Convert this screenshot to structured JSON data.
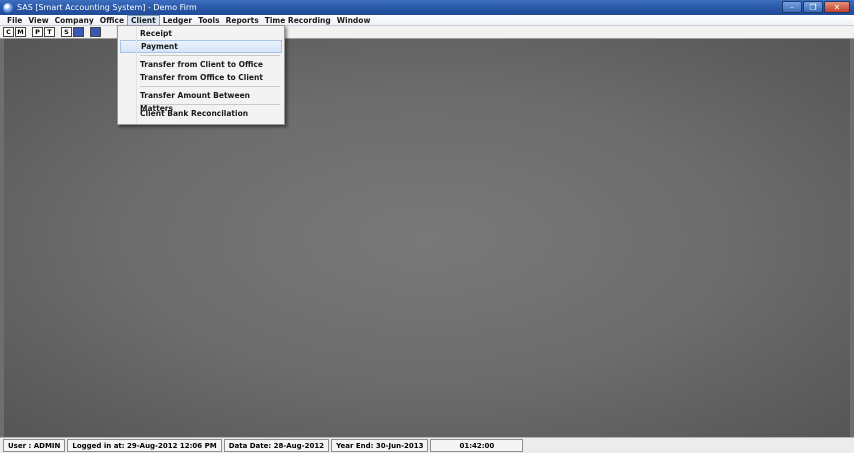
{
  "window": {
    "title": "SAS [Smart Accounting System] - Demo Firm",
    "buttons": {
      "minimize": "–",
      "restore": "❐",
      "close": "✕"
    }
  },
  "menubar": {
    "items": [
      "File",
      "View",
      "Company",
      "Office",
      "Client",
      "Ledger",
      "Tools",
      "Reports",
      "Time Recording",
      "Window"
    ],
    "active": "Client"
  },
  "toolbar": {
    "buttons": [
      "C",
      "M",
      "P",
      "T",
      "S",
      "",
      ""
    ]
  },
  "client_menu": {
    "items": [
      {
        "label": "Receipt"
      },
      {
        "label": "Payment"
      },
      {
        "label": "Transfer from Client to Office"
      },
      {
        "label": "Transfer from Office to Client"
      },
      {
        "label": "Transfer Amount Between Matters"
      },
      {
        "label": "Client Bank Reconcilation"
      }
    ],
    "highlighted": "Payment"
  },
  "statusbar": {
    "user": "User : ADMIN",
    "logged_in": "Logged in at: 29-Aug-2012 12:06 PM",
    "data_date": "Data Date: 28-Aug-2012",
    "year_end": "Year End: 30-Jun-2013",
    "clock": "01:42:00"
  },
  "colors": {
    "titlebar": "#2a5aaa",
    "workspace": "#6e6e6e",
    "menu_highlight": "#d4e4f7"
  }
}
